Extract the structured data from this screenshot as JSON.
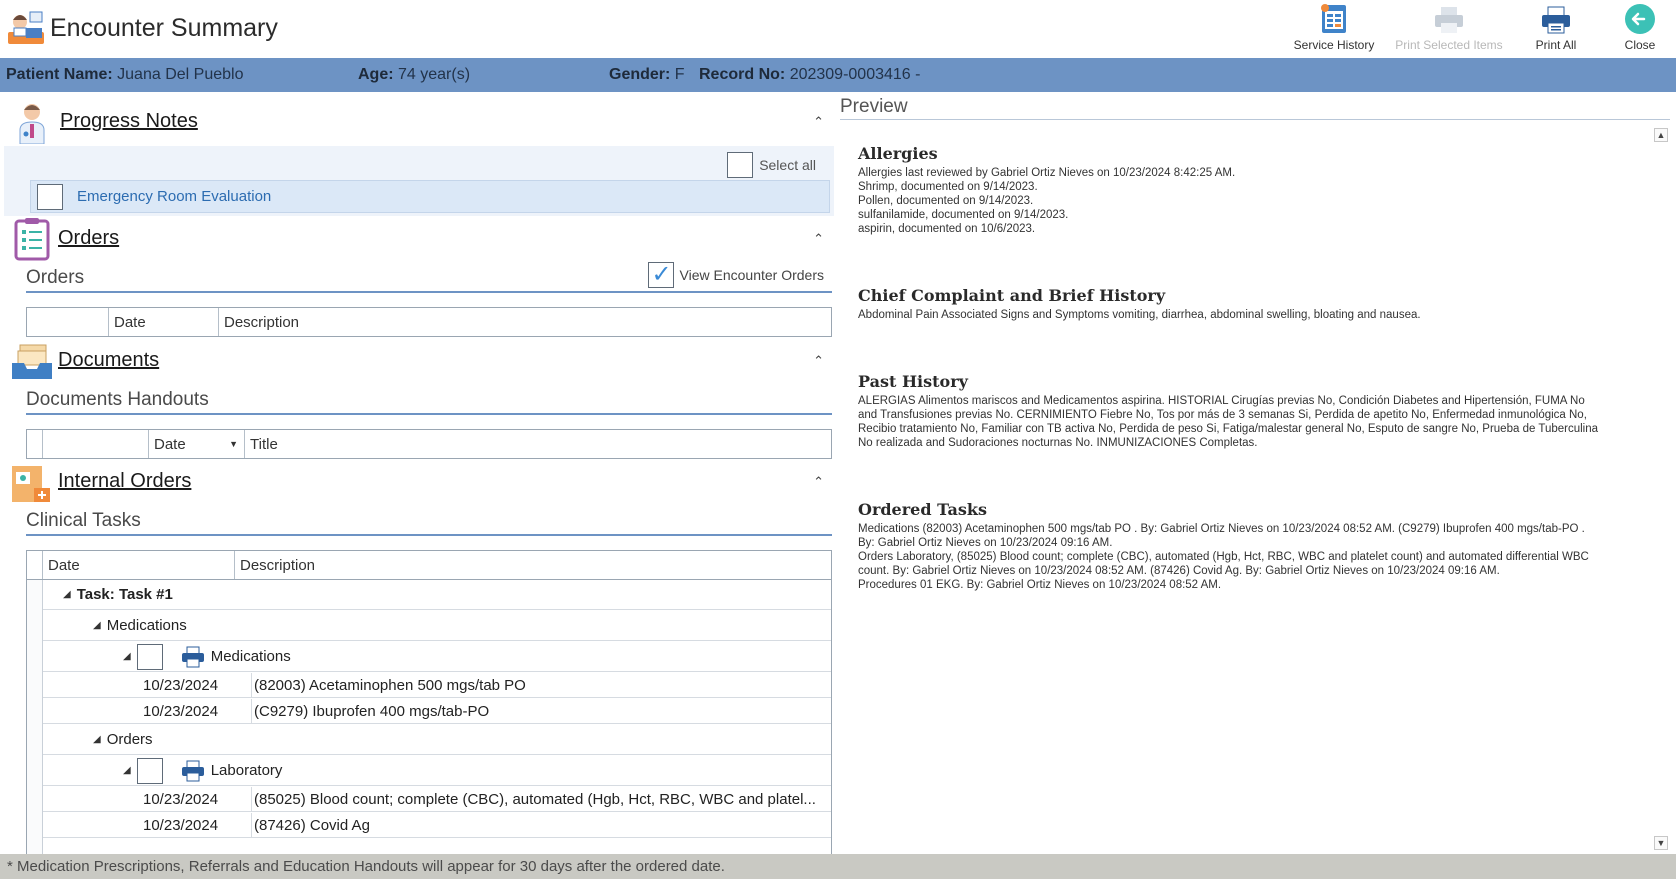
{
  "window": {
    "title": "Encounter Summary"
  },
  "toolbar": {
    "service_history": "Service History",
    "print_selected": "Print Selected Items",
    "print_all": "Print All",
    "close": "Close"
  },
  "patient": {
    "name_label": "Patient Name:",
    "name": "Juana Del Pueblo",
    "age_label": "Age:",
    "age": "74 year(s)",
    "gender_label": "Gender:",
    "gender": "F",
    "record_label": "Record No:",
    "record": "202309-0003416 -"
  },
  "progress_notes": {
    "title": "Progress Notes",
    "select_all": "Select all",
    "items": [
      "Emergency Room Evaluation"
    ]
  },
  "orders": {
    "title": "Orders",
    "subtitle": "Orders",
    "view_encounter_orders": "View Encounter Orders",
    "view_encounter_orders_checked": true,
    "columns": [
      "Date",
      "Description"
    ]
  },
  "documents": {
    "title": "Documents",
    "subtitle": "Documents Handouts",
    "columns": [
      "Date",
      "Title"
    ]
  },
  "internal_orders": {
    "title": "Internal Orders",
    "subtitle": "Clinical Tasks",
    "columns": [
      "Date",
      "Description"
    ],
    "task_label": "Task: Task #1",
    "groups": [
      {
        "label": "Medications",
        "subgroup": "Medications",
        "rows": [
          {
            "date": "10/23/2024",
            "desc": "(82003) Acetaminophen 500 mgs/tab PO"
          },
          {
            "date": "10/23/2024",
            "desc": "(C9279) Ibuprofen 400 mgs/tab-PO"
          }
        ]
      },
      {
        "label": "Orders",
        "subgroup": "Laboratory",
        "rows": [
          {
            "date": "10/23/2024",
            "desc": "(85025) Blood count; complete (CBC), automated (Hgb, Hct, RBC, WBC and platel..."
          },
          {
            "date": "10/23/2024",
            "desc": "(87426) Covid Ag"
          }
        ]
      }
    ]
  },
  "preview": {
    "title": "Preview",
    "sections": [
      {
        "heading": "Allergies",
        "lines": [
          "Allergies last reviewed by Gabriel Ortiz Nieves on 10/23/2024 8:42:25 AM.",
          "Shrimp, documented on 9/14/2023.",
          "Pollen, documented on 9/14/2023.",
          "sulfanilamide, documented on 9/14/2023.",
          "aspirin, documented on 10/6/2023."
        ]
      },
      {
        "heading": "Chief Complaint and Brief History",
        "lines": [
          "Abdominal Pain Associated Signs and Symptoms vomiting, diarrhea, abdominal swelling, bloating and nausea."
        ]
      },
      {
        "heading": "Past History",
        "lines": [
          "ALERGIAS Alimentos mariscos and Medicamentos aspirina. HISTORIAL Cirugías previas No, Condición Diabetes and Hipertensión, FUMA No",
          "and Transfusiones previas No. CERNIMIENTO Fiebre No, Tos por más de 3 semanas Si, Perdida de apetito No, Enfermedad inmunológica No,",
          "Recibio tratamiento No, Familiar con TB activa No, Perdida de peso Si, Fatiga/malestar general No, Esputo de sangre No, Prueba de Tuberculina",
          "No realizada and Sudoraciones nocturnas No. INMUNIZACIONES Completas."
        ]
      },
      {
        "heading": "Ordered Tasks",
        "lines": [
          "Medications (82003) Acetaminophen 500 mgs/tab PO . By: Gabriel Ortiz Nieves on 10/23/2024 08:52 AM. (C9279) Ibuprofen 400 mgs/tab-PO .",
          "By: Gabriel Ortiz Nieves on 10/23/2024 09:16 AM.",
          "Orders Laboratory, (85025) Blood count; complete (CBC), automated (Hgb, Hct, RBC, WBC and platelet count) and automated differential WBC",
          "count. By: Gabriel Ortiz Nieves on 10/23/2024 08:52 AM. (87426) Covid Ag. By: Gabriel Ortiz Nieves on 10/23/2024 09:16 AM.",
          "Procedures 01 EKG. By: Gabriel Ortiz Nieves on 10/23/2024 08:52 AM."
        ]
      }
    ]
  },
  "footer": {
    "note": "* Medication Prescriptions, Referrals and Education Handouts will appear for 30 days after the ordered date."
  },
  "colors": {
    "accent": "#6d93c4",
    "footer": "#c9c9c3",
    "link": "#2c6cb1"
  }
}
